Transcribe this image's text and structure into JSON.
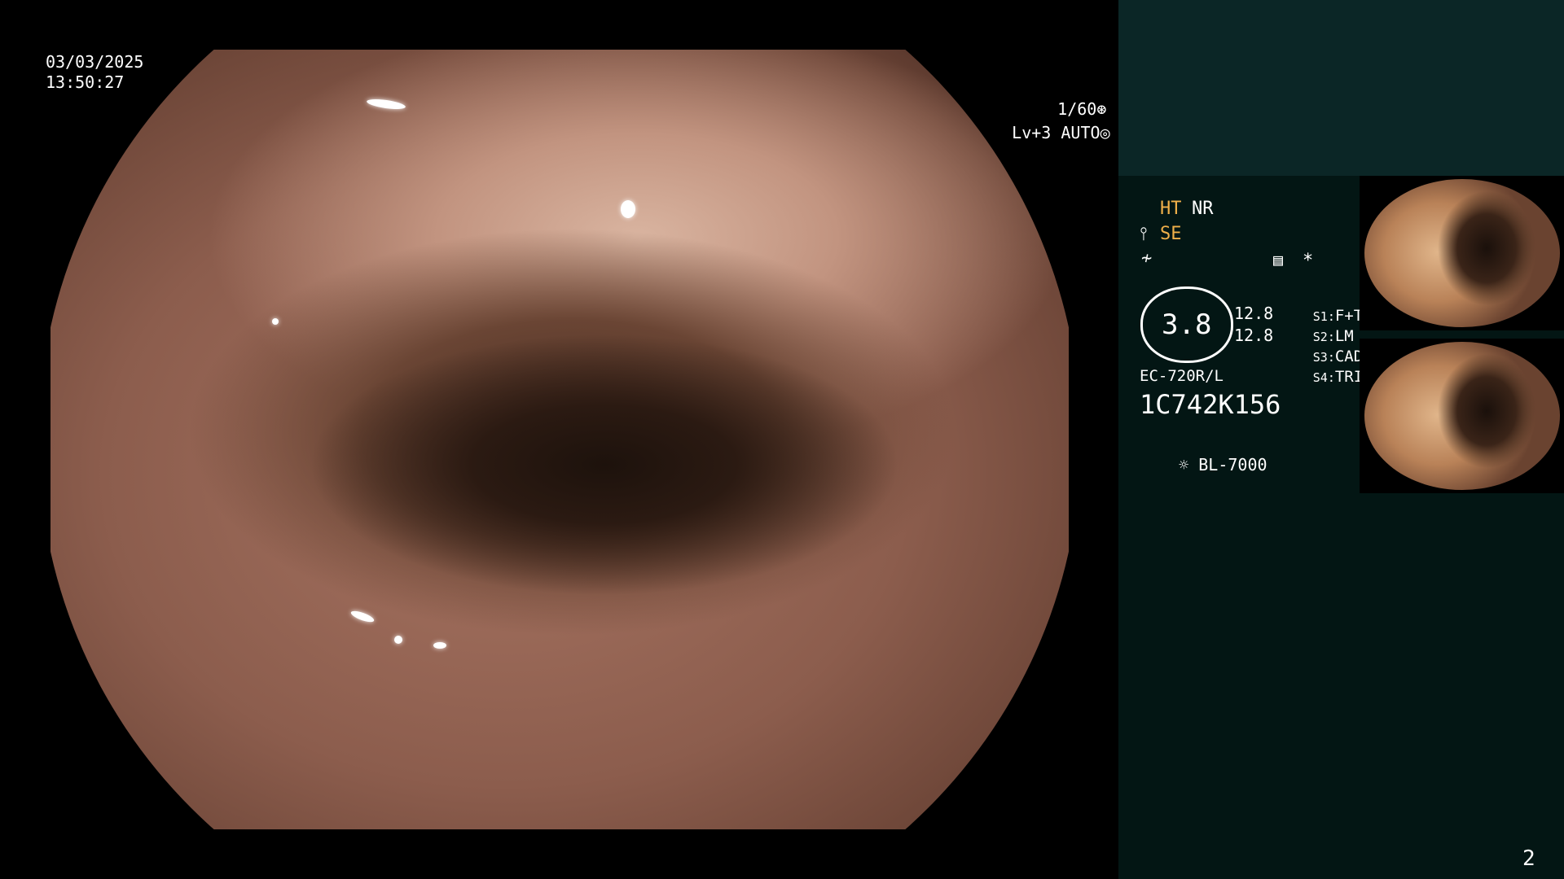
{
  "view": {
    "date": "03/03/2025",
    "time": "13:50:27",
    "shutter": "1/60",
    "level": "Lv+3",
    "mode": "AUTO"
  },
  "panel": {
    "ht": "HT",
    "nr": "NR",
    "se": "SE",
    "zoom": "3.8",
    "val_a": "12.8",
    "val_b": "12.8",
    "s1_key": "S1:",
    "s1_val": "F+T",
    "s2_key": "S2:",
    "s2_val": "LM",
    "s3_key": "S3:",
    "s3_val": "CAD",
    "s4_key": "S4:",
    "s4_val": "TRIG",
    "scope_model": "EC-720R/L",
    "scope_serial": "1C742K156",
    "light_source": "BL-7000",
    "asterisk": "*",
    "page_number": "2"
  },
  "colors": {
    "panel_bg": "#031614",
    "panel_top": "#0b2626",
    "accent": "#f0b04a"
  },
  "icons": [
    "shutter-icon",
    "auto-iris-icon",
    "structure-enhance-icon",
    "color-enhance-icon",
    "settings-menu-icon",
    "lamp-icon"
  ]
}
